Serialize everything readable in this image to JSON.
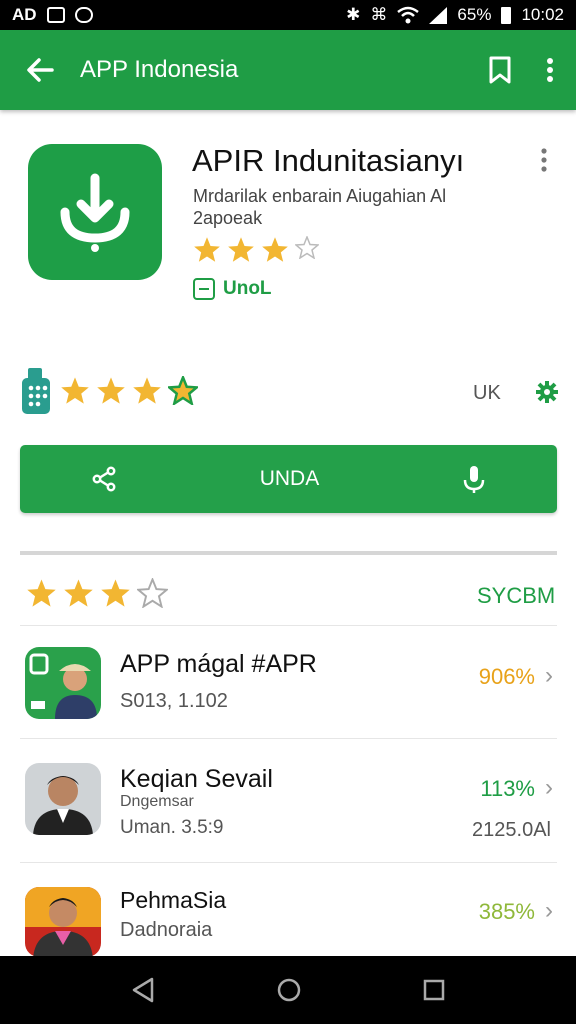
{
  "status_bar": {
    "left_icons": [
      "AD",
      "mail-icon",
      "cloud-icon"
    ],
    "battery_percent": "65%",
    "time": "10:02"
  },
  "app_bar": {
    "title": "APP Indonesia",
    "icons": [
      "back-arrow-icon",
      "bookmark-icon",
      "more-vert-icon"
    ]
  },
  "app": {
    "name": "APIR Indunitasianyı",
    "description_line1": "Mrdarilak enbarain Aiugahian Al",
    "description_line2": "2apoeak",
    "rating_stars": 3,
    "installed_label": "UnoL",
    "brand_color": "#1f9d45"
  },
  "rating_row": {
    "stars": 4,
    "locale": "UK"
  },
  "action_bar": {
    "label": "UNDA",
    "icons": [
      "share-icon",
      "mic-icon"
    ]
  },
  "reviews": {
    "stars": 3,
    "link_label": "SYCBM"
  },
  "list": [
    {
      "title": "APP mágal #APR",
      "subtitle": "S013, 1.102",
      "percent": "906%",
      "percent_color": "#e8a21a"
    },
    {
      "title": "Keqian Sevail",
      "subtitle": "Dngemsar",
      "subtitle2": "Uman. 3.5:9",
      "percent": "113%",
      "percent_color": "#1f9d45",
      "extra": "2125.0Al"
    },
    {
      "title": "PehmaSia",
      "subtitle": "Dadnoraia",
      "percent": "385%",
      "percent_color": "#8fb83a"
    }
  ],
  "nav_bar": {
    "icons": [
      "back-triangle-icon",
      "home-circle-icon",
      "recents-square-icon"
    ]
  }
}
